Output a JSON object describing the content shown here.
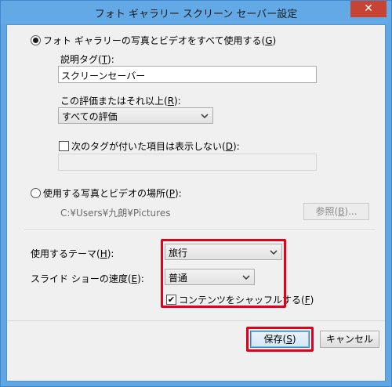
{
  "window": {
    "title": "フォト ギャラリー スクリーン セーバー設定",
    "close_glyph": "✕"
  },
  "option_gallery": {
    "label_pre": "フォト ギャラリーの写真とビデオをすべて使用する(",
    "key": "G",
    "label_post": ")",
    "checked": true
  },
  "tag_description": {
    "label_pre": "説明タグ(",
    "key": "T",
    "label_post": "):",
    "value": "スクリーンセーバー"
  },
  "rating": {
    "label_pre": "この評価またはそれ以上(",
    "key": "R",
    "label_post": "):",
    "value": "すべての評価"
  },
  "exclude_tags": {
    "label_pre": "次のタグが付いた項目は表示しない(",
    "key": "D",
    "label_post": "):",
    "checked": false,
    "value": ""
  },
  "option_folder": {
    "label_pre": "使用する写真とビデオの場所(",
    "key": "P",
    "label_post": "):",
    "checked": false,
    "path": "C:¥Users¥九朗¥Pictures"
  },
  "browse_button": {
    "label_pre": "参照(",
    "key": "B",
    "label_post": ")..."
  },
  "theme": {
    "label_pre": "使用するテーマ(",
    "key": "H",
    "label_post": "):",
    "value": "旅行"
  },
  "speed": {
    "label_pre": "スライド ショーの速度(",
    "key": "E",
    "label_post": "):",
    "value": "普通"
  },
  "shuffle": {
    "label_pre": "コンテンツをシャッフルする(",
    "key": "F",
    "label_post": ")",
    "checked": true,
    "check_glyph": "✔"
  },
  "save_button": {
    "label_pre": "保存(",
    "key": "S",
    "label_post": ")"
  },
  "cancel_button": {
    "label": "キャンセル"
  },
  "colors": {
    "highlight": "#e3001b",
    "titlebar": "#63a9e6",
    "close": "#c74434"
  }
}
